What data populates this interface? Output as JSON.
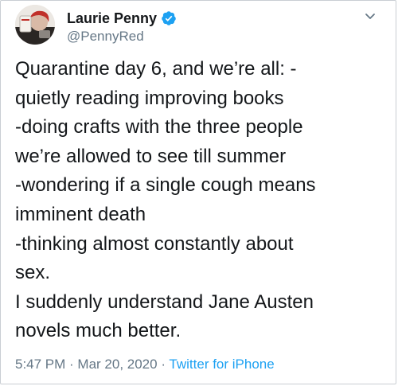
{
  "author": {
    "display_name": "Laurie Penny",
    "handle": "@PennyRed",
    "verified_icon": "verified-badge-icon"
  },
  "tweet": {
    "lines": [
      "Quarantine day 6, and we’re all: -",
      "quietly reading improving books",
      "-doing crafts with the three people",
      "we’re allowed to see till summer",
      "-wondering if a single cough means",
      "imminent death",
      "-thinking almost constantly about",
      "sex.",
      "I suddenly understand Jane Austen",
      "novels much better."
    ]
  },
  "meta": {
    "time": "5:47 PM",
    "separator_1": " · ",
    "date": "Mar 20, 2020",
    "separator_2": " · ",
    "source": "Twitter for iPhone"
  },
  "colors": {
    "text": "#14171a",
    "secondary": "#657786",
    "accent": "#1da1f2"
  }
}
